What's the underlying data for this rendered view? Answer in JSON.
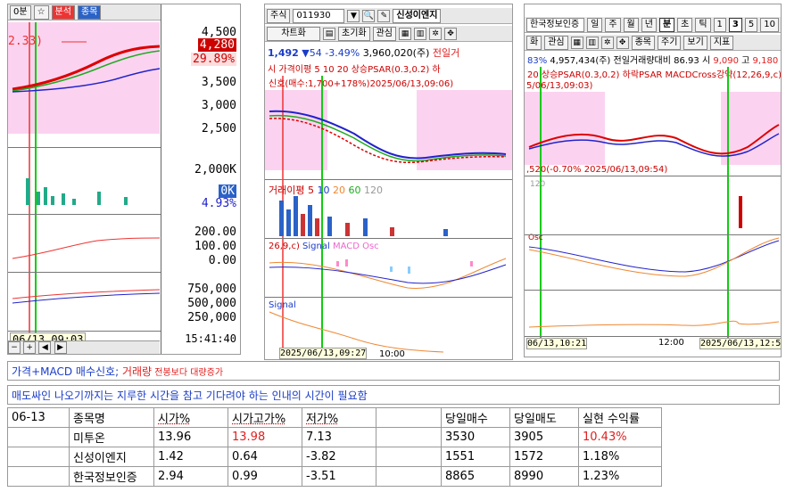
{
  "panel1": {
    "toolbar_items": [
      "0분",
      "☆",
      "분석",
      "종목"
    ],
    "annotation": "2.33)",
    "price_axis": [
      "4,500",
      "4,280",
      "29.89%",
      "3,500",
      "3,000",
      "2,500"
    ],
    "volume_axis": [
      "2,000K",
      "0K",
      "4.93%"
    ],
    "macd_axis": [
      "200.00",
      "100.00",
      "0.00"
    ],
    "obv_axis": [
      "750,000",
      "500,000",
      "250,000"
    ],
    "date_label": "06/13,09:03",
    "time_label": "15:41:40",
    "current_price": "4,280",
    "current_rate": "29.89%"
  },
  "panel2": {
    "market": "주식",
    "code": "011930",
    "stock_name": "신성이엔지",
    "tabs": [
      "차트화",
      "초기화",
      "관심"
    ],
    "quote": {
      "price": "1,492",
      "change": "▼54",
      "rate": "-3.49%",
      "amount": "3,960,020(주)",
      "label": "전일거"
    },
    "legend": "시 가격이평 5 10 20 상승PSAR(0.3,0.2) 하",
    "signal_text": "신호(매수:1,700+178%)2025/06/13,09:06)",
    "volume_legend": [
      "거래이평 5",
      "10",
      "20",
      "60",
      "120"
    ],
    "macd_legend": [
      "26,9,c)",
      "Signal",
      "MACD Osc"
    ],
    "signal_legend": "Signal",
    "date_label": "2025/06/13,09:27",
    "time_label": "10:00"
  },
  "panel3": {
    "stock_name": "한국정보인증",
    "periods": [
      "일",
      "주",
      "월",
      "년",
      "분",
      "초",
      "틱",
      "1",
      "3",
      "5",
      "10"
    ],
    "selected_period": "3",
    "tabs": [
      "화",
      "관심"
    ],
    "nav_buttons": [
      "종목",
      "주기",
      "보기",
      "지표"
    ],
    "quote": {
      "rate": "83%",
      "amount": "4,957,434(주)",
      "label": "전일거래량대비",
      "ratio": "86.93",
      "open_label": "시",
      "open": "9,090",
      "high_label": "고",
      "high": "9,180"
    },
    "legend": "20 상승PSAR(0.3,0.2) 하락PSAR MACDCross강약(12,26,9,c) Pa",
    "signal_text": "5/06/13,09:03)",
    "volume_text": ",520(-0.70% 2025/06/13,09:54)",
    "volume_legend": "120",
    "macd_label": "Osc",
    "date_left": "06/13,10:21",
    "time_mid": "12:00",
    "date_right": "2025/06/13,12:54"
  },
  "captions": {
    "line1_a": "가격+MACD 매수신호; ",
    "line1_b": "거래량",
    "line1_c": " 전봉보다 대량증가",
    "line2": "매도싸인 나오기까지는 지루한 시간을 참고 기다려야 하는 인내의 시간이 필요함"
  },
  "table": {
    "headers": [
      "06-13",
      "종목명",
      "시가%",
      "시가고가%",
      "저가%",
      "",
      "당일매수",
      "당일매도",
      "실현 수익률"
    ],
    "rows": [
      {
        "date": "",
        "name": "미투온",
        "open": "13.96",
        "high": "13.98",
        "low": "7.13",
        "blank": "",
        "buy": "3530",
        "sell": "3905",
        "profit": "10.43%"
      },
      {
        "date": "",
        "name": "신성이엔지",
        "open": "1.42",
        "high": "0.64",
        "low": "-3.82",
        "blank": "",
        "buy": "1551",
        "sell": "1572",
        "profit": "1.18%"
      },
      {
        "date": "",
        "name": "한국정보인증",
        "open": "2.94",
        "high": "0.99",
        "low": "-3.51",
        "blank": "",
        "buy": "8865",
        "sell": "8990",
        "profit": "1.23%"
      }
    ]
  }
}
